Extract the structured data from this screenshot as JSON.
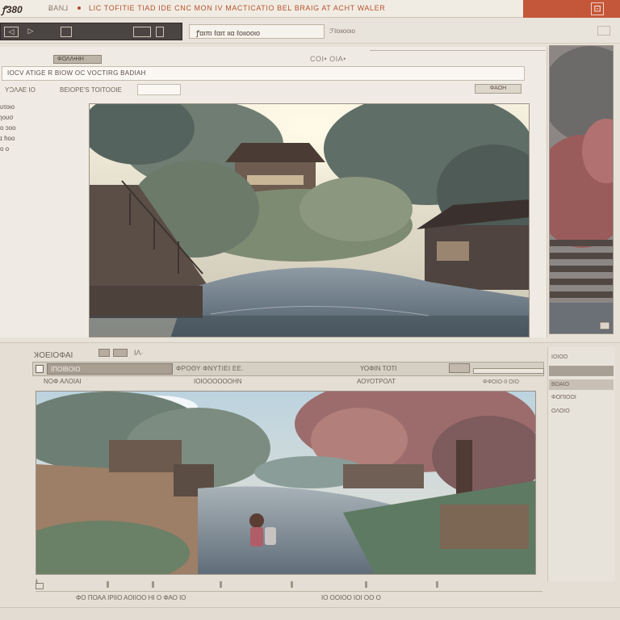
{
  "window": {
    "logo": "ꝭ380",
    "title_text": "ɃAN⅃",
    "accent_text": "LIC TOFITIE TIAD IDE CNC MON IV MACTICATIO BEL BRAIG AT ACHT WALER",
    "close_glyph": "⊡"
  },
  "toolbar": {
    "url_text": "ꝭαιπι ℓαιτ ιια ℓοιιοοιο",
    "url_right": "ℱℓοιιοοιο"
  },
  "top_panel": {
    "tab_chip": "ΦΟΛΛ•ΗΗ",
    "title": "COI• OIA•",
    "search_text": "IOCV ATIGE R BIOW OC VOCTIRG BADIAH",
    "sub_left": "ΥƆΛΑΕ ΙΟ",
    "sub_mid": "ΒΕΙΟΡΕ'S ΤΟΙΤΟΟΙΕ",
    "sub_right": "ΦΑΟΗ",
    "side_items": [
      "υτοιο",
      "ɿουσ",
      "ο ɔοο",
      "ɪ ɦοο",
      "ο ο"
    ]
  },
  "bottom_panel": {
    "head": "ꞰΟΕΙΟΦΑΙ",
    "head_tail": "ΙΛ·",
    "field1": "ΙΠΟΙΒΟΙΟ",
    "text1": "ΦΡΟΘΥ ΦΝΥΤΙΕΙ ΕΕ.",
    "text2": "ΥΟΦΙΝ ΤΟΤΙ",
    "row2a": "ΝΟΦ ΑΛΟΙΑΙ",
    "row2b": "ΙΟΙΟΟΟΟΟΟΗΝ",
    "row2c": "ΑΟΥΟΤΡΟΛΤ",
    "row2d": "ΦΦΟΙΟ-ΙΙ ΟΙΟ",
    "right_items": [
      "ΙΟΙΟΟ",
      "",
      "ΒΟΑΙΟ",
      "ΦΟΠΙΟΟΙ",
      "ΟΛΟΙΟ"
    ],
    "status_left": "Ɫ",
    "status_center": "ΦΟ ΠΟΑΑ ΙΡΙΙΟ ΑΟΙΙΟΟ ΗΙ Ο ΦΑΟ ΙΟ",
    "status_right": "ΙΟ ΟΟΙΟΟ ΙΟΙ ΟΟ Ο"
  },
  "colors": {
    "accent": "#c4573a",
    "panel": "#efebe4",
    "dark_toolbar": "#4a4443"
  },
  "icons": [
    "app-logo-icon",
    "close-icon",
    "back-icon",
    "forward-icon",
    "stop-icon",
    "home-icon",
    "settings-icon"
  ]
}
